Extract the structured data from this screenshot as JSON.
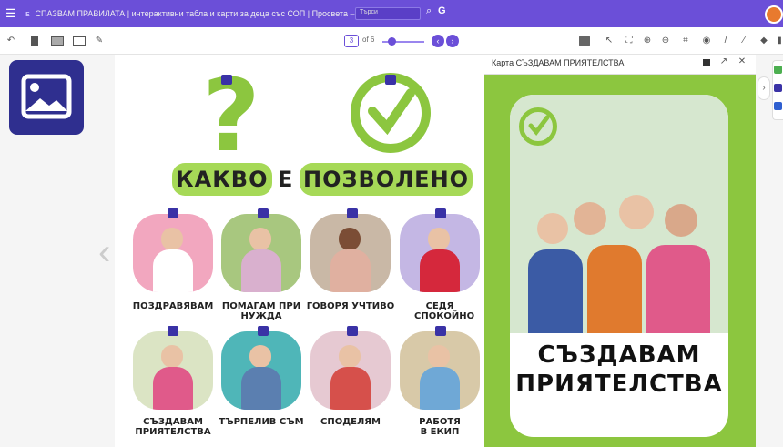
{
  "app": {
    "logo_text": "ᴇ",
    "title": "СПАЗВАМ ПРАВИЛАТА | интерактивни табла и карти за деца със СОП | Просвета – София",
    "search_placeholder": "Търси"
  },
  "toolbar": {
    "page_current": "3",
    "page_of": "of 6"
  },
  "page": {
    "heading_left": "КАКВО",
    "heading_mid": "Е",
    "heading_right": "ПОЗВОЛЕНО",
    "cards": [
      {
        "label": "ПОЗДРАВЯВАМ"
      },
      {
        "label": "ПОМАГАМ ПРИ НУЖДА"
      },
      {
        "label": "ГОВОРЯ УЧТИВО"
      },
      {
        "label": "СЕДЯ СПОКОЙНО"
      },
      {
        "label": "СЪЗДАВАМ ПРИЯТЕЛСТВА"
      },
      {
        "label": "ТЪРПЕЛИВ СЪМ"
      },
      {
        "label": "СПОДЕЛЯМ"
      },
      {
        "label": "РАБОТЯ В ЕКИП"
      }
    ]
  },
  "panel": {
    "title": "Карта СЪЗДАВАМ ПРИЯТЕЛСТВА",
    "poster_line1": "СЪЗДАВАМ",
    "poster_line2": "ПРИЯТЕЛСТВА"
  },
  "colors": {
    "accent": "#6b4fd8",
    "green": "#8cc63f",
    "highlight": "#a6d957",
    "navy": "#2f2f8f"
  }
}
